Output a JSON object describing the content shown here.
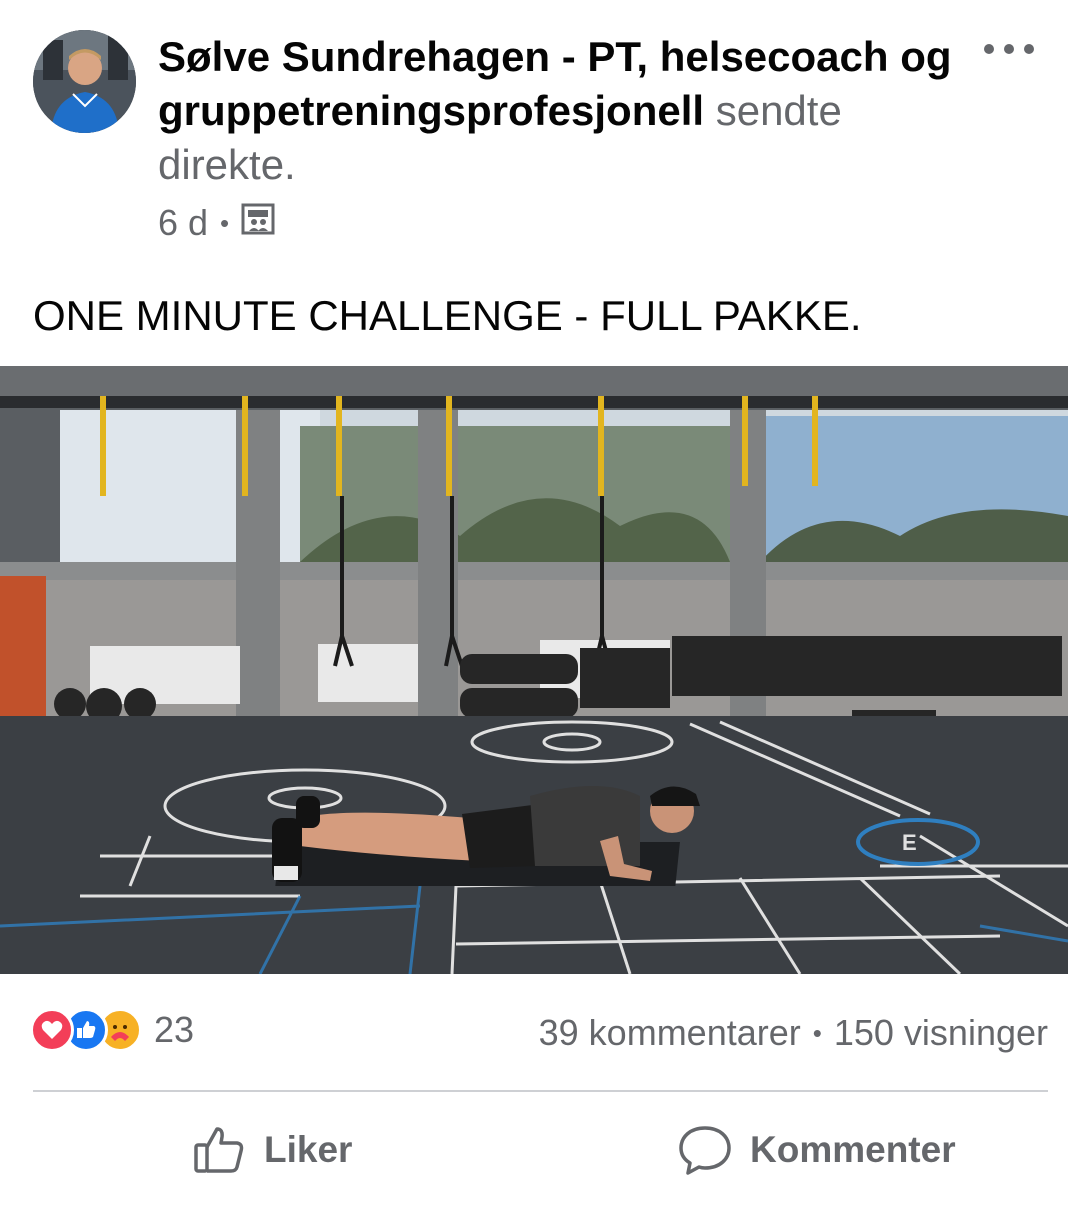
{
  "post": {
    "author": "Sølve Sundrehagen - PT, helsecoach og gruppetreningsprofesjonell",
    "action": "sendte direkte.",
    "time": "6 d",
    "audience_icon": "custom-audience-icon",
    "caption": "ONE MINUTE CHALLENGE - FULL PAKKE."
  },
  "engagement": {
    "reaction_icons": [
      "love-reaction-icon",
      "like-reaction-icon",
      "care-reaction-icon"
    ],
    "reaction_count": "23",
    "comments": "39 kommentarer",
    "views": "150 visninger"
  },
  "actions": {
    "like_label": "Liker",
    "comment_label": "Kommenter"
  },
  "colors": {
    "like_blue": "#1877f2",
    "love_red": "#f33e58",
    "care_yellow": "#f7b125",
    "secondary_text": "#65676b"
  }
}
